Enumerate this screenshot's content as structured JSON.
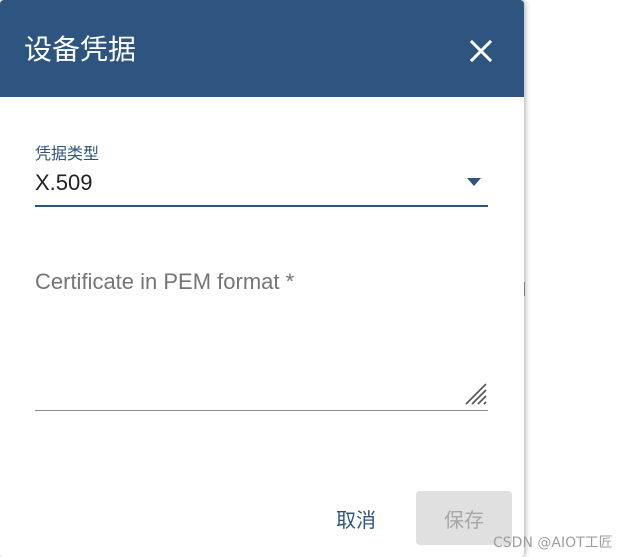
{
  "dialog": {
    "title": "设备凭据",
    "close_icon": "close-icon",
    "header_color": "#2e557f"
  },
  "credentials_type": {
    "label": "凭据类型",
    "value": "X.509",
    "dropdown_icon": "caret-down-icon"
  },
  "certificate": {
    "placeholder": "Certificate in PEM format *",
    "value": ""
  },
  "actions": {
    "cancel_label": "取消",
    "save_label": "保存"
  },
  "watermark": "CSDN @AIOT工匠"
}
